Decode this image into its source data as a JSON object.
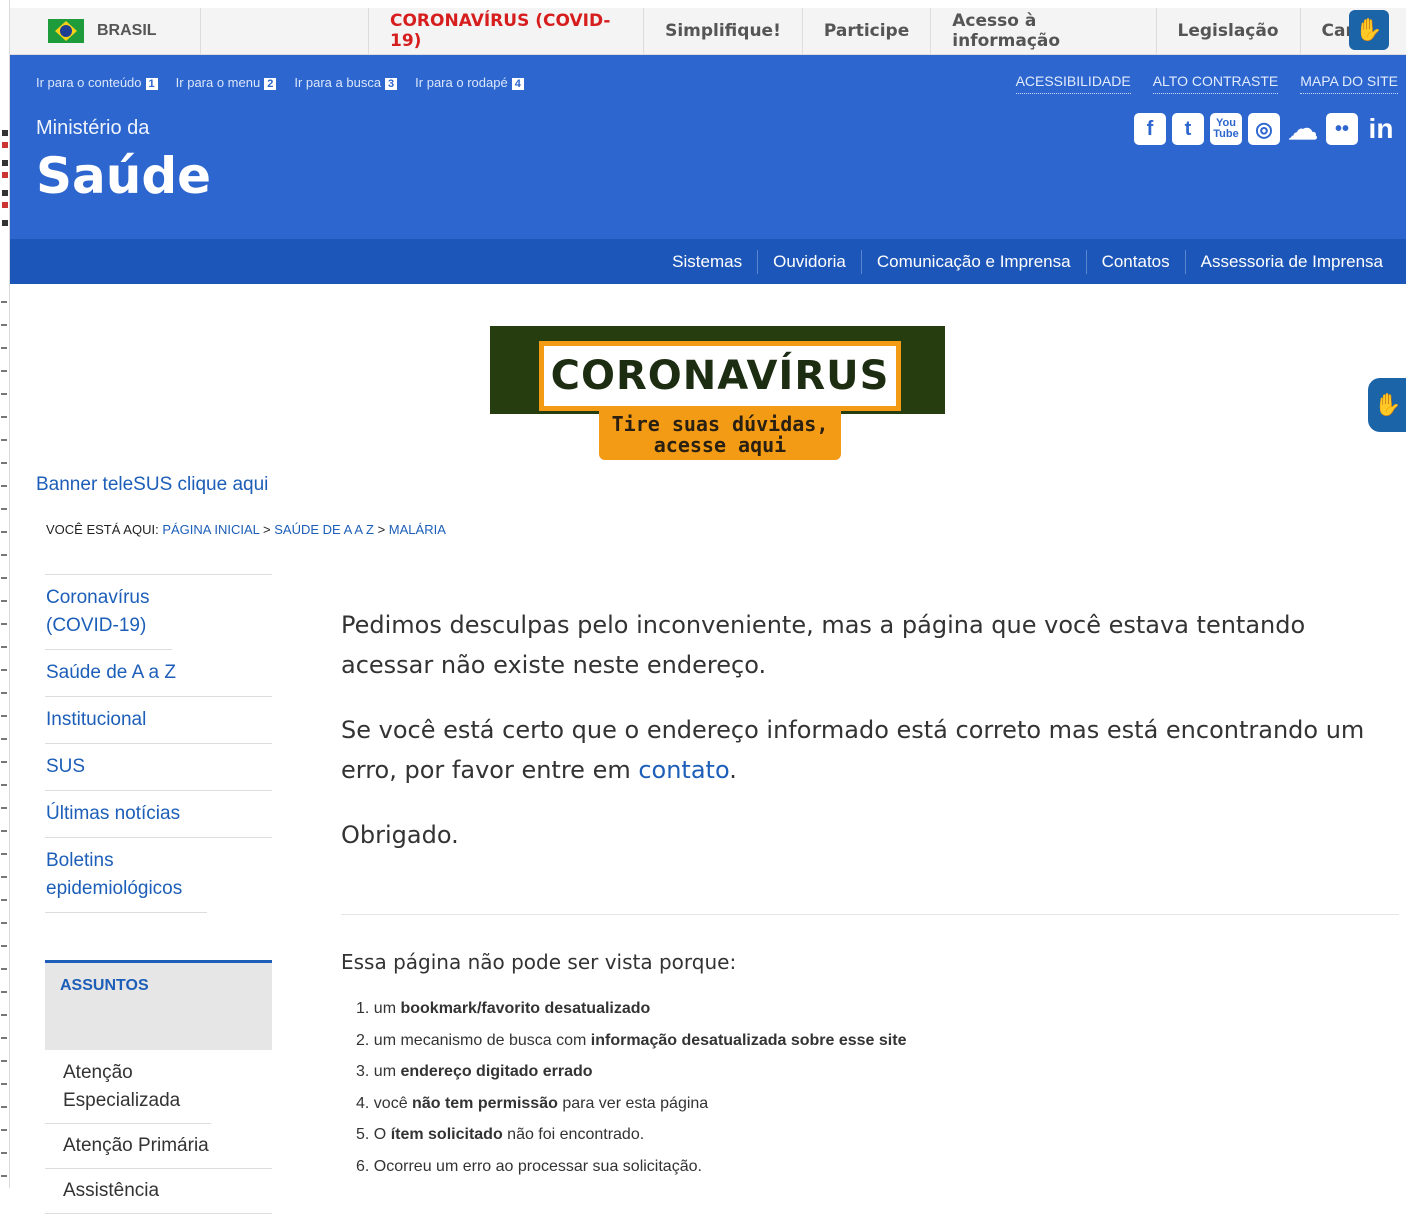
{
  "gov_bar": {
    "brand": "BRASIL",
    "links": [
      {
        "label": "CORONAVÍRUS (COVID-19)",
        "highlight": true
      },
      {
        "label": "Simplifique!"
      },
      {
        "label": "Participe"
      },
      {
        "label": "Acesso à informação"
      },
      {
        "label": "Legislação"
      },
      {
        "label": "Canais"
      }
    ],
    "accessibility_icon": "sign-language-hands-icon"
  },
  "header": {
    "skip_links": [
      {
        "label": "Ir para o conteúdo",
        "key": "1"
      },
      {
        "label": "Ir para o menu",
        "key": "2"
      },
      {
        "label": "Ir para a busca",
        "key": "3"
      },
      {
        "label": "Ir para o rodapé",
        "key": "4"
      }
    ],
    "top_links": [
      "ACESSIBILIDADE",
      "ALTO CONTRASTE",
      "MAPA DO SITE"
    ],
    "ministry_line": "Ministério da",
    "ministry_name": "Saúde",
    "social_icons": [
      "facebook-icon",
      "twitter-icon",
      "youtube-icon",
      "instagram-icon",
      "cloud-icon",
      "flickr-icon",
      "linkedin-icon"
    ],
    "services": [
      "Sistemas",
      "Ouvidoria",
      "Comunicação e Imprensa",
      "Contatos",
      "Assessoria de Imprensa"
    ]
  },
  "banner": {
    "title": "CORONAVÍRUS",
    "subtitle_line1": "Tire suas dúvidas,",
    "subtitle_line2": "acesse aqui"
  },
  "telesus_link": "Banner teleSUS clique aqui",
  "breadcrumb": {
    "prefix": "VOCÊ ESTÁ AQUI:",
    "items": [
      "PÁGINA INICIAL",
      "SAÚDE DE A A Z",
      "MALÁRIA"
    ],
    "separator": ">"
  },
  "side_nav": [
    "Coronavírus (COVID-19)",
    "Saúde de A a Z",
    "Institucional",
    "SUS",
    "Últimas notícias",
    "Boletins epidemiológicos"
  ],
  "assuntos": {
    "title": "ASSUNTOS",
    "items": [
      "Atenção Especializada",
      "Atenção Primária",
      "Assistência"
    ]
  },
  "message": {
    "p1": "Pedimos desculpas pelo inconveniente, mas a página que você estava tentando acessar não existe neste endereço.",
    "p2_before": "Se você está certo que o endereço informado está correto mas está encontrando um erro, por favor entre em ",
    "p2_link": "contato",
    "p2_after": ".",
    "p3": "Obrigado."
  },
  "reasons": {
    "title": "Essa página não pode ser vista porque:",
    "items": [
      {
        "n": "1.",
        "pre": "um ",
        "bold": "bookmark/favorito desatualizado",
        "post": ""
      },
      {
        "n": "2.",
        "pre": "um mecanismo de busca com ",
        "bold": "informação desatualizada sobre esse site",
        "post": ""
      },
      {
        "n": "3.",
        "pre": "um ",
        "bold": "endereço digitado errado",
        "post": ""
      },
      {
        "n": "4.",
        "pre": "você ",
        "bold": "não tem permissão",
        "post": " para ver esta página"
      },
      {
        "n": "5.",
        "pre": "O ",
        "bold": "ítem solicitado",
        "post": " não foi encontrado."
      },
      {
        "n": "6.",
        "pre": "Ocorreu um erro ao processar sua solicitação.",
        "bold": "",
        "post": ""
      }
    ]
  },
  "colors": {
    "header_blue": "#2c66ce",
    "service_bar_blue": "#1d56b9",
    "link_blue": "#1c5eb8",
    "covid_red": "#d71e1e",
    "banner_green": "#263d10",
    "banner_orange": "#f39b15"
  }
}
